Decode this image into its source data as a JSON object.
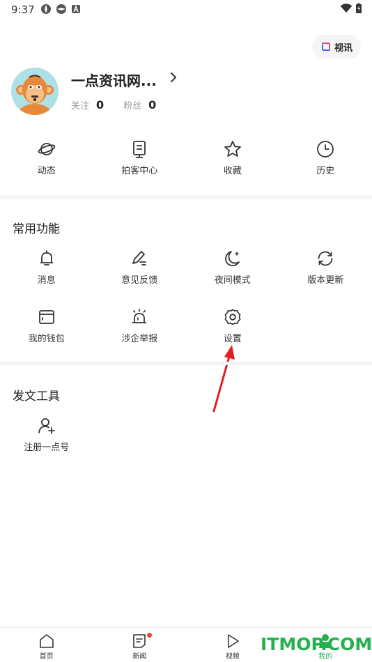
{
  "status_bar": {
    "time": "9:37"
  },
  "header": {
    "video_chat_label": "视讯"
  },
  "profile": {
    "username": "一点资讯网...",
    "following_label": "关注",
    "following_count": "0",
    "followers_label": "粉丝",
    "followers_count": "0"
  },
  "quick_actions": [
    {
      "label": "动态",
      "icon": "planet-icon"
    },
    {
      "label": "拍客中心",
      "icon": "camera-device-icon"
    },
    {
      "label": "收藏",
      "icon": "star-icon"
    },
    {
      "label": "历史",
      "icon": "clock-icon"
    }
  ],
  "common_functions": {
    "title": "常用功能",
    "items": [
      {
        "label": "消息",
        "icon": "bell-icon"
      },
      {
        "label": "意见反馈",
        "icon": "edit-pen-icon"
      },
      {
        "label": "夜间模式",
        "icon": "moon-icon"
      },
      {
        "label": "版本更新",
        "icon": "refresh-icon"
      },
      {
        "label": "我的钱包",
        "icon": "wallet-icon"
      },
      {
        "label": "涉企举报",
        "icon": "alarm-icon"
      },
      {
        "label": "设置",
        "icon": "gear-icon"
      }
    ]
  },
  "posting_tools": {
    "title": "发文工具",
    "items": [
      {
        "label": "注册一点号",
        "icon": "add-user-icon"
      }
    ]
  },
  "bottom_nav": [
    {
      "label": "首页",
      "icon": "home-icon"
    },
    {
      "label": "新闻",
      "icon": "news-icon"
    },
    {
      "label": "视频",
      "icon": "play-icon"
    },
    {
      "label": "我的",
      "icon": "person-icon"
    }
  ],
  "watermark": "ITMOP.COM",
  "colors": {
    "accent_green": "#22b14c",
    "arrow_red": "#e02020",
    "badge_red": "#ee4433"
  }
}
